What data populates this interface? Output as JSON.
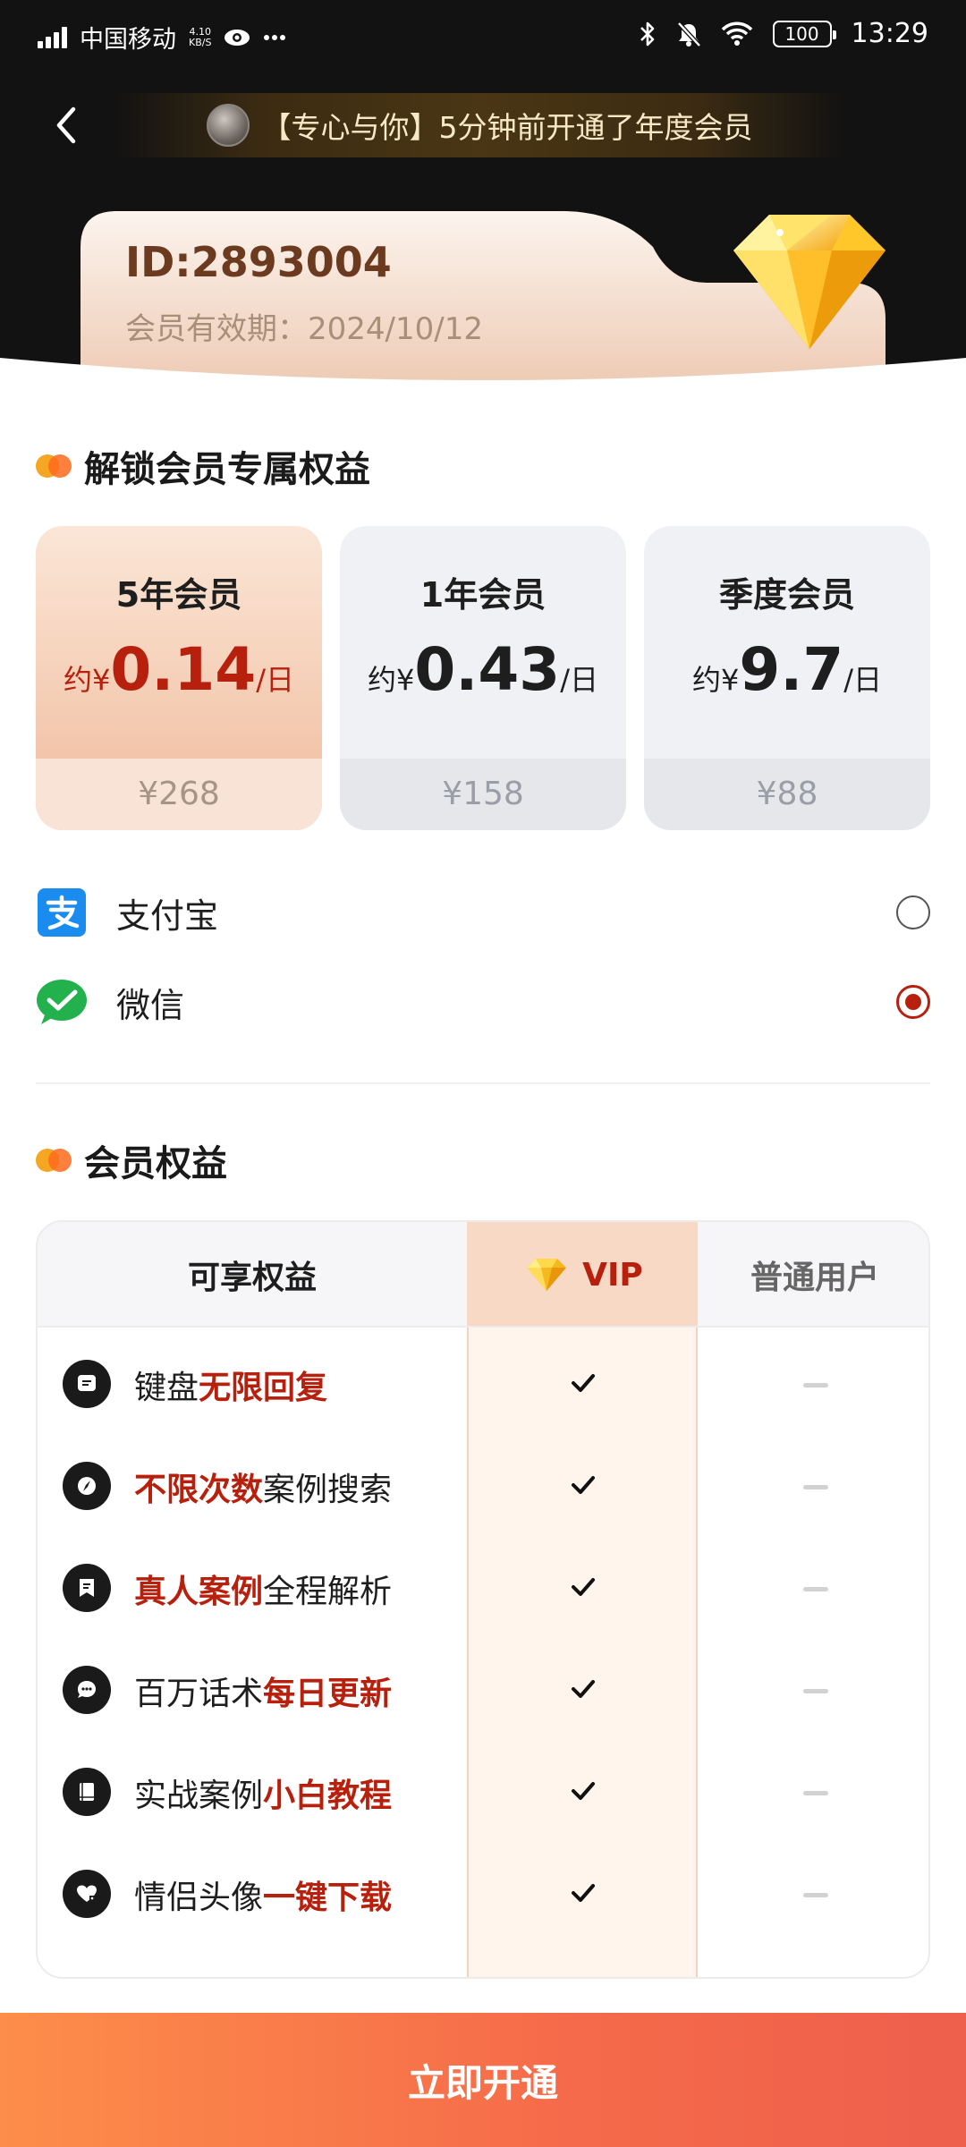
{
  "status_bar": {
    "carrier": "中国移动",
    "net_speed_value": "4.10",
    "net_speed_unit": "KB/S",
    "battery": "100",
    "time": "13:29"
  },
  "header": {
    "notice_text": "【专心与你】5分钟前开通了年度会员"
  },
  "member": {
    "id_text": "ID:2893004",
    "expiry_text": "会员有效期：2024/10/12"
  },
  "plans_section": {
    "title": "解锁会员专属权益",
    "plans": [
      {
        "name": "5年会员",
        "price_prefix": "约¥",
        "price_value": "0.14",
        "price_suffix": "/日",
        "total": "¥268",
        "selected": true
      },
      {
        "name": "1年会员",
        "price_prefix": "约¥",
        "price_value": "0.43",
        "price_suffix": "/日",
        "total": "¥158",
        "selected": false
      },
      {
        "name": "季度会员",
        "price_prefix": "约¥",
        "price_value": "9.7",
        "price_suffix": "/日",
        "total": "¥88",
        "selected": false
      }
    ]
  },
  "payment": {
    "options": [
      {
        "label": "支付宝",
        "icon": "alipay-icon",
        "selected": false
      },
      {
        "label": "微信",
        "icon": "wechat-icon",
        "selected": true
      }
    ]
  },
  "benefits_section": {
    "title": "会员权益",
    "columns": [
      "可享权益",
      "VIP",
      "普通用户"
    ],
    "rows": [
      {
        "icon": "message-icon",
        "text_a": "键盘",
        "highlight": "无限回复",
        "text_b": ""
      },
      {
        "icon": "compass-icon",
        "text_a": "",
        "highlight": "不限次数",
        "text_b": "案例搜索"
      },
      {
        "icon": "document-icon",
        "text_a": "",
        "highlight": "真人案例",
        "text_b": "全程解析"
      },
      {
        "icon": "chat-bubble-icon",
        "text_a": "百万话术",
        "highlight": "每日更新",
        "text_b": ""
      },
      {
        "icon": "book-icon",
        "text_a": "实战案例",
        "highlight": "小白教程",
        "text_b": ""
      },
      {
        "icon": "heart-icon",
        "text_a": "情侣头像",
        "highlight": "一键下载",
        "text_b": ""
      }
    ]
  },
  "cta": {
    "label": "立即开通"
  },
  "colors": {
    "accent_red": "#b8200e",
    "cta_start": "#fd8d4a",
    "cta_end": "#ee5f4c",
    "header_bg": "#121212"
  }
}
